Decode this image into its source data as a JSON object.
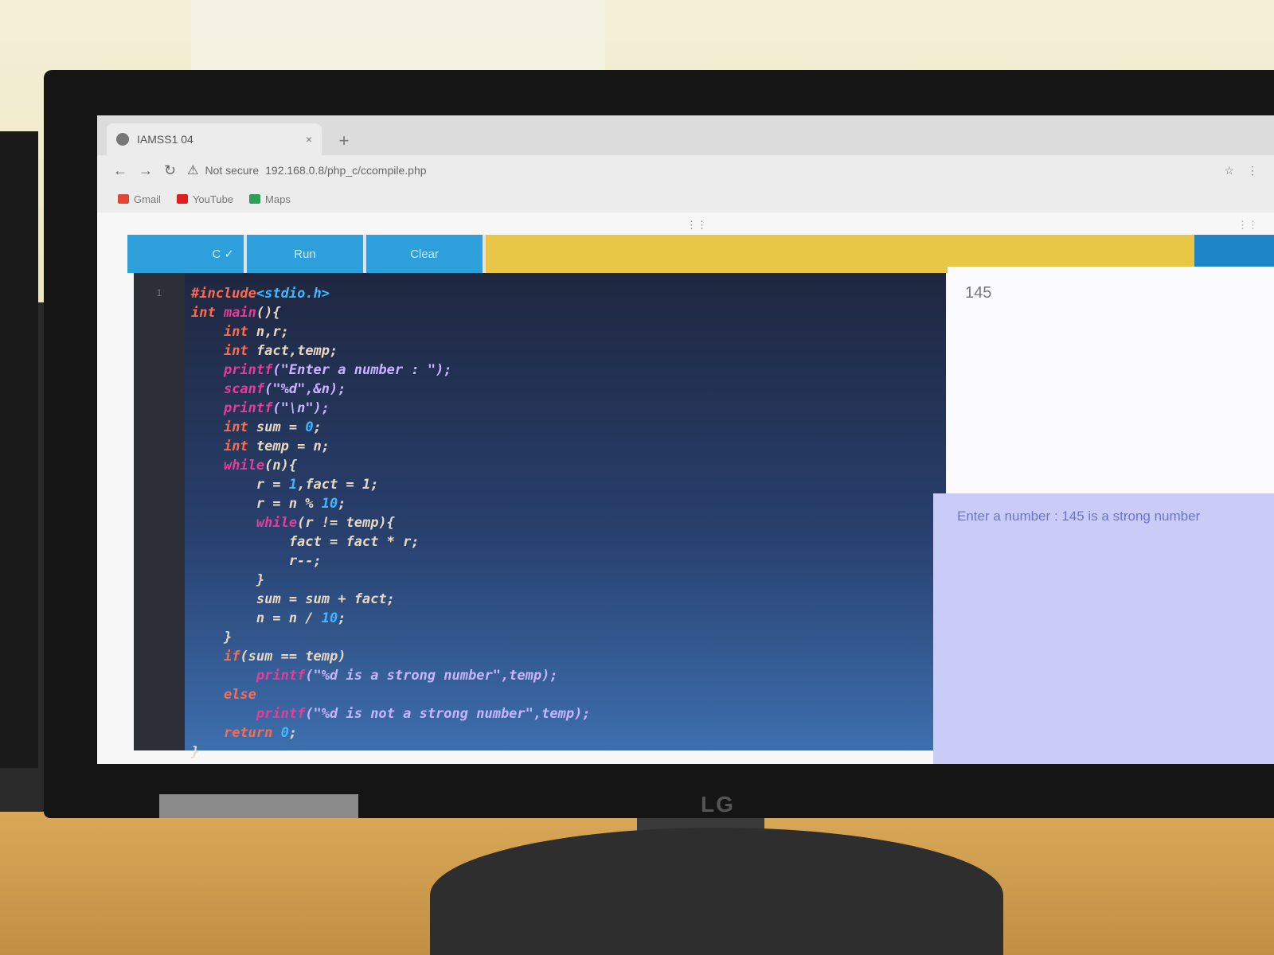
{
  "browser": {
    "tab_title": "IAMSS1 04",
    "tab_close": "×",
    "new_tab": "+",
    "security": "Not secure",
    "url": "192.168.0.8/php_c/ccompile.php",
    "bookmarks": [
      {
        "label": "Gmail",
        "color": "#e0453a"
      },
      {
        "label": "YouTube",
        "color": "#e02020"
      },
      {
        "label": "Maps",
        "color": "#2e9e58"
      }
    ]
  },
  "toolbar": {
    "buttons": [
      {
        "label": "C ✓"
      },
      {
        "label": "Run"
      },
      {
        "label": "Clear"
      }
    ]
  },
  "editor": {
    "gutter_marker": "1"
  },
  "code_lines": [
    [
      {
        "c": "k",
        "t": "#include"
      },
      {
        "c": "n",
        "t": "<stdio.h>"
      }
    ],
    [
      {
        "c": "k",
        "t": "int "
      },
      {
        "c": "f",
        "t": "main"
      },
      {
        "c": "t",
        "t": "(){"
      }
    ],
    [
      {
        "c": "t",
        "t": "    "
      },
      {
        "c": "k",
        "t": "int "
      },
      {
        "c": "t",
        "t": "n,r;"
      }
    ],
    [
      {
        "c": "t",
        "t": "    "
      },
      {
        "c": "k",
        "t": "int "
      },
      {
        "c": "t",
        "t": "fact,temp;"
      }
    ],
    [
      {
        "c": "t",
        "t": "    "
      },
      {
        "c": "f",
        "t": "printf"
      },
      {
        "c": "p",
        "t": "(\"Enter a number : \");"
      }
    ],
    [
      {
        "c": "t",
        "t": "    "
      },
      {
        "c": "f",
        "t": "scanf"
      },
      {
        "c": "p",
        "t": "(\"%d\",&n);"
      }
    ],
    [
      {
        "c": "t",
        "t": "    "
      },
      {
        "c": "f",
        "t": "printf"
      },
      {
        "c": "p",
        "t": "(\"\\n\");"
      }
    ],
    [
      {
        "c": "t",
        "t": "    "
      },
      {
        "c": "k",
        "t": "int "
      },
      {
        "c": "t",
        "t": "sum = "
      },
      {
        "c": "n",
        "t": "0"
      },
      {
        "c": "t",
        "t": ";"
      }
    ],
    [
      {
        "c": "t",
        "t": "    "
      },
      {
        "c": "k",
        "t": "int "
      },
      {
        "c": "t",
        "t": "temp = n;"
      }
    ],
    [
      {
        "c": "t",
        "t": "    "
      },
      {
        "c": "f",
        "t": "while"
      },
      {
        "c": "t",
        "t": "(n){"
      }
    ],
    [
      {
        "c": "t",
        "t": "        r = "
      },
      {
        "c": "n",
        "t": "1"
      },
      {
        "c": "t",
        "t": ",fact = 1;"
      }
    ],
    [
      {
        "c": "t",
        "t": "        r = n % "
      },
      {
        "c": "n",
        "t": "10"
      },
      {
        "c": "t",
        "t": ";"
      }
    ],
    [
      {
        "c": "t",
        "t": "        "
      },
      {
        "c": "f",
        "t": "while"
      },
      {
        "c": "t",
        "t": "(r != temp){"
      }
    ],
    [
      {
        "c": "t",
        "t": "            fact = fact * r;"
      }
    ],
    [
      {
        "c": "t",
        "t": "            r--;"
      }
    ],
    [
      {
        "c": "t",
        "t": "        }"
      }
    ],
    [
      {
        "c": "t",
        "t": "        sum = sum + fact;"
      }
    ],
    [
      {
        "c": "t",
        "t": "        n = n / "
      },
      {
        "c": "n",
        "t": "10"
      },
      {
        "c": "t",
        "t": ";"
      }
    ],
    [
      {
        "c": "t",
        "t": "    }"
      }
    ],
    [
      {
        "c": "t",
        "t": "    "
      },
      {
        "c": "k",
        "t": "if"
      },
      {
        "c": "t",
        "t": "(sum == temp)"
      }
    ],
    [
      {
        "c": "t",
        "t": "        "
      },
      {
        "c": "f",
        "t": "printf"
      },
      {
        "c": "p",
        "t": "(\"%d is a strong number\",temp);"
      }
    ],
    [
      {
        "c": "t",
        "t": "    "
      },
      {
        "c": "k",
        "t": "else"
      }
    ],
    [
      {
        "c": "t",
        "t": "        "
      },
      {
        "c": "f",
        "t": "printf"
      },
      {
        "c": "p",
        "t": "(\"%d is not a strong number\",temp);"
      }
    ],
    [
      {
        "c": "t",
        "t": "    "
      },
      {
        "c": "k",
        "t": "return "
      },
      {
        "c": "n",
        "t": "0"
      },
      {
        "c": "t",
        "t": ";"
      }
    ],
    [
      {
        "c": "t",
        "t": "}"
      }
    ]
  ],
  "input_panel": {
    "value": "145"
  },
  "output_panel": {
    "text": "Enter a number : 145 is a strong number"
  },
  "monitor": {
    "brand": "LG"
  }
}
